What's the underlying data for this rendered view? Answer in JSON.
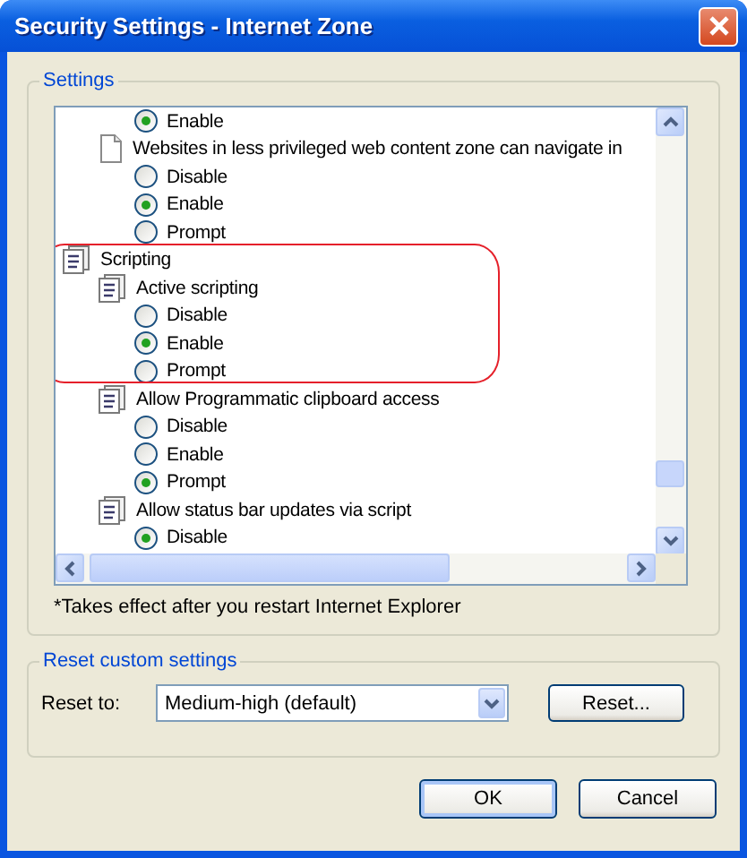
{
  "window": {
    "title": "Security Settings - Internet Zone"
  },
  "settings": {
    "legend": "Settings",
    "items": [
      {
        "kind": "option",
        "label": "Enable",
        "selected": true
      },
      {
        "kind": "page",
        "label": "Websites in less privileged web content zone can navigate in",
        "children": [
          {
            "kind": "option",
            "label": "Disable",
            "selected": false
          },
          {
            "kind": "option",
            "label": "Enable",
            "selected": true
          },
          {
            "kind": "option",
            "label": "Prompt",
            "selected": false
          }
        ]
      },
      {
        "kind": "category",
        "label": "Scripting",
        "children": [
          {
            "kind": "script",
            "label": "Active scripting",
            "children": [
              {
                "kind": "option",
                "label": "Disable",
                "selected": false
              },
              {
                "kind": "option",
                "label": "Enable",
                "selected": true
              },
              {
                "kind": "option",
                "label": "Prompt",
                "selected": false
              }
            ]
          },
          {
            "kind": "script",
            "label": "Allow Programmatic clipboard access",
            "children": [
              {
                "kind": "option",
                "label": "Disable",
                "selected": false
              },
              {
                "kind": "option",
                "label": "Enable",
                "selected": false
              },
              {
                "kind": "option",
                "label": "Prompt",
                "selected": true
              }
            ]
          },
          {
            "kind": "script",
            "label": "Allow status bar updates via script",
            "children": [
              {
                "kind": "option",
                "label": "Disable",
                "selected": true
              }
            ]
          }
        ]
      }
    ],
    "note": "*Takes effect after you restart Internet Explorer"
  },
  "reset": {
    "legend": "Reset custom settings",
    "label": "Reset to:",
    "value": "Medium-high (default)",
    "button": "Reset..."
  },
  "buttons": [
    {
      "label": "OK",
      "default": true
    },
    {
      "label": "Cancel",
      "default": false
    }
  ]
}
